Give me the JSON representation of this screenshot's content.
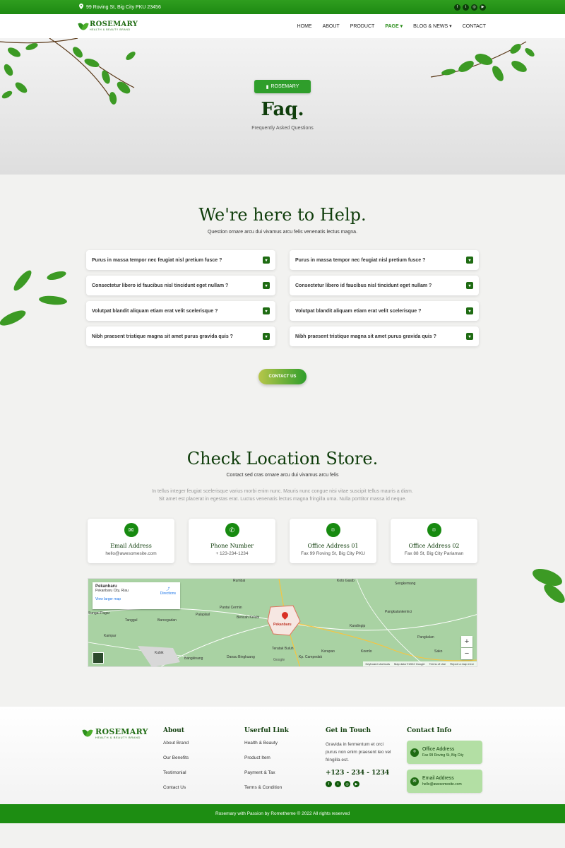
{
  "topbar": {
    "address": "99 Roving St, Big City PKU 23456",
    "social_icons": [
      "facebook-icon",
      "twitter-icon",
      "instagram-icon",
      "youtube-icon"
    ]
  },
  "brand": {
    "name": "ROSEMARY",
    "tagline": "HEALTH & BEAUTY BRAND"
  },
  "nav": {
    "items": [
      "HOME",
      "ABOUT",
      "PRODUCT",
      "PAGE",
      "BLOG & NEWS",
      "CONTACT"
    ],
    "active": "PAGE"
  },
  "hero": {
    "badge": "ROSEMARY",
    "title": "Faq.",
    "subtitle": "Frequently Asked Questions"
  },
  "faq": {
    "title": "We're here to Help.",
    "subtitle": "Question ornare arcu dui vivamus arcu felis venenatis lectus magna.",
    "left": [
      "Purus in massa tempor nec feugiat nisl pretium fusce ?",
      "Consectetur libero id faucibus nisl tincidunt eget nullam ?",
      "Volutpat blandit aliquam etiam erat velit scelerisque ?",
      "Nibh praesent tristique magna sit amet purus gravida quis ?"
    ],
    "right": [
      "Purus in massa tempor nec feugiat nisl pretium fusce ?",
      "Consectetur libero id faucibus nisl tincidunt eget nullam ?",
      "Volutpat blandit aliquam etiam erat velit scelerisque ?",
      "Nibh praesent tristique magna sit amet purus gravida quis ?"
    ],
    "cta": "CONTACT US"
  },
  "location": {
    "title": "Check Location Store.",
    "subtitle": "Contact sed cras ornare arcu dui vivamus arcu felis",
    "para1": "In tellus integer feugiat scelerisque varius morbi enim nunc. Mauris nunc congue nisi vitae suscipit tellus mauris a diam.",
    "para2": "Sit amet est placerat in egestas erat. Luctus venenatis lectus magna fringilla urna. Nulla porttitor massa id neque.",
    "cards": [
      {
        "icon": "email-icon",
        "title": "Email Address",
        "value": "hello@awesomesite.com"
      },
      {
        "icon": "phone-icon",
        "title": "Phone Number",
        "value": "+ 123-234-1234"
      },
      {
        "icon": "location-pin-icon",
        "title": "Office Address 01",
        "value": "Fax 99 Roving St, Big City PKU"
      },
      {
        "icon": "location-pin-icon",
        "title": "Office Address 02",
        "value": "Fax 88 St, Big City Pariaman"
      }
    ]
  },
  "map": {
    "place": "Pekanbaru",
    "region": "Pekanbaru City, Riau",
    "directions": "Directions",
    "larger": "View larger map",
    "labels": [
      "Rumbai",
      "Koto Gasib",
      "Sengkemang",
      "Pantai Cermin",
      "Palaplasl",
      "Bencah Kelubi",
      "Sungai Pagar",
      "Pangkalankerinci",
      "Tanggul",
      "Barcegadan",
      "Kampar",
      "Pekanbaru",
      "Kandingip",
      "Teratak Buluh",
      "Kerapao",
      "Koenlo",
      "Pangkalan",
      "Kubik",
      "Bangkinang",
      "Danau Bingkuang",
      "Kp. Campedak",
      "Sako"
    ],
    "footer": [
      "Keyboard shortcuts",
      "Map data ©2022 Google",
      "Terms of Use",
      "Report a map error"
    ],
    "logo": "Google"
  },
  "footer": {
    "about_title": "About",
    "about_links": [
      "About Brand",
      "Our Benefits",
      "Testimonial",
      "Contact Us"
    ],
    "useful_title": "Userful Link",
    "useful_links": [
      "Health & Beauty",
      "Product Item",
      "Payment & Tax",
      "Terms & Condition"
    ],
    "touch_title": "Get in Touch",
    "touch_text": "Gravida in fermentum et orci purus non enim praesent leo vel fringilla est.",
    "phone": "+123 - 234 - 1234",
    "contact_title": "Contact Info",
    "contact": [
      {
        "icon": "location-pin-icon",
        "label": "Office Address",
        "value": "Fax 99 Roving St, Big City"
      },
      {
        "icon": "email-icon",
        "label": "Email Address",
        "value": "hello@awesomesite.com"
      }
    ],
    "copyright": "Rosemary with Passion by Rometheme © 2022 All rights reserved"
  },
  "colors": {
    "primary": "#1d8d12",
    "dark": "#0f3d0b",
    "accent_light": "#b3dfa4"
  }
}
